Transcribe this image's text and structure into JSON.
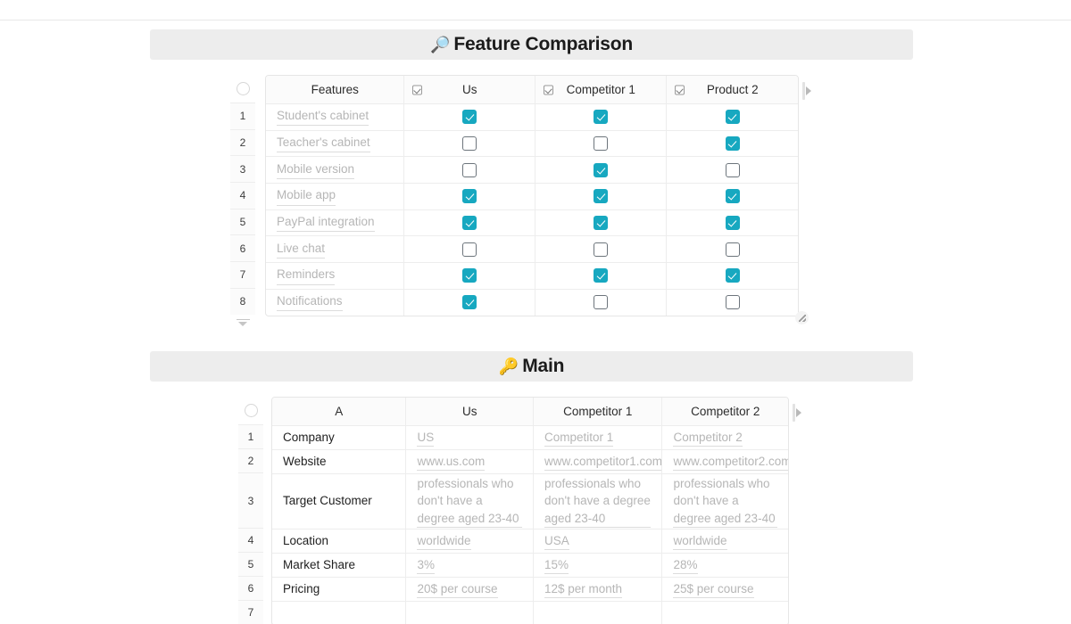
{
  "sections": [
    {
      "id": "feature-comparison",
      "emoji": "🔎",
      "title": "Feature Comparison",
      "columns": [
        "Features",
        "Us",
        "Competitor 1",
        "Product 2"
      ],
      "header_checkbox_columns": [
        false,
        true,
        true,
        true
      ],
      "row_numbers": [
        "1",
        "2",
        "3",
        "4",
        "5",
        "6",
        "7",
        "8"
      ],
      "rows": [
        {
          "feature": "Student's cabinet",
          "values": [
            true,
            true,
            true
          ]
        },
        {
          "feature": "Teacher's cabinet",
          "values": [
            false,
            false,
            true
          ]
        },
        {
          "feature": "Mobile version",
          "values": [
            false,
            true,
            false
          ]
        },
        {
          "feature": "Mobile app",
          "values": [
            true,
            true,
            true
          ]
        },
        {
          "feature": "PayPal integration",
          "values": [
            true,
            true,
            true
          ]
        },
        {
          "feature": "Live chat",
          "values": [
            false,
            false,
            false
          ]
        },
        {
          "feature": "Reminders",
          "values": [
            true,
            true,
            true
          ]
        },
        {
          "feature": "Notifications",
          "values": [
            true,
            false,
            false
          ]
        }
      ]
    },
    {
      "id": "main",
      "emoji": "🔑",
      "title": "Main",
      "columns": [
        "A",
        "Us",
        "Competitor 1",
        "Competitor 2"
      ],
      "header_checkbox_columns": [
        false,
        false,
        false,
        false
      ],
      "row_numbers": [
        "1",
        "2",
        "3",
        "4",
        "5",
        "6",
        "7"
      ],
      "rows": [
        {
          "key": "Company",
          "values": [
            "US",
            "Competitor 1",
            "Competitor 2"
          ]
        },
        {
          "key": "Website",
          "values": [
            "www.us.com",
            "www.competitor1.com",
            "www.competitor2.com"
          ]
        },
        {
          "key": "Target Customer",
          "values": [
            "professionals who don't have a degree aged 23-40",
            "professionals who don't have a degree aged 23-40",
            "professionals who don't have a degree aged 23-40"
          ]
        },
        {
          "key": "Location",
          "values": [
            "worldwide",
            "USA",
            "worldwide"
          ]
        },
        {
          "key": "Market Share",
          "values": [
            "3%",
            "15%",
            "28%"
          ]
        },
        {
          "key": "Pricing",
          "values": [
            "20$ per course",
            "12$ per month",
            "25$ per course"
          ]
        },
        {
          "key": "",
          "values": [
            "",
            "",
            ""
          ]
        }
      ]
    }
  ],
  "colors": {
    "checked": "#17a8c0",
    "unchecked_border": "#6d757c",
    "banner_bg": "#ededed",
    "muted_text": "#b6b6b6",
    "dark_text": "#1f1f1f"
  }
}
